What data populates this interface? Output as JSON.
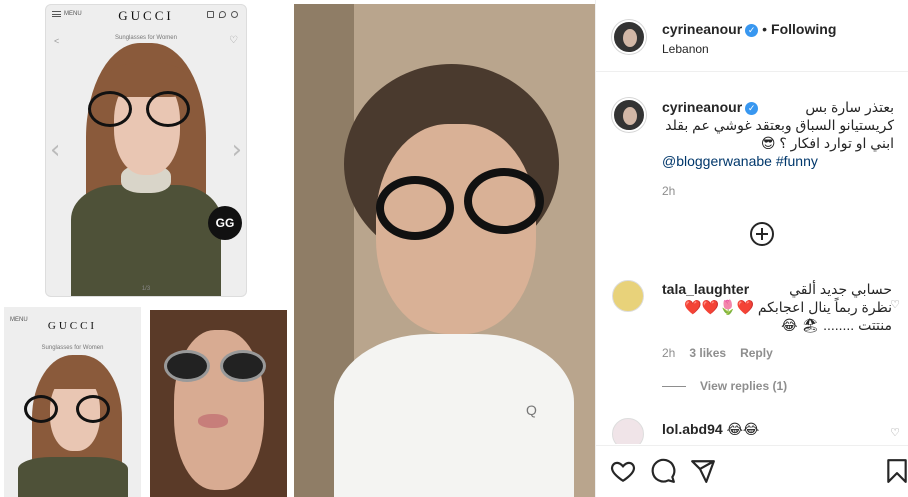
{
  "media": {
    "gucci_main": {
      "menu_label": "MENU",
      "brand": "GUCCI",
      "subtitle": "Sunglasses for Women",
      "page_indicator": "1/3",
      "badge": "GG"
    },
    "gucci_small": {
      "menu_label": "MENU",
      "brand": "GUCCI",
      "subtitle": "Sunglasses for Women"
    },
    "toddler_shirt_logo": "Q"
  },
  "post": {
    "author": "cyrineanour",
    "follow_status": "Following",
    "location": "Lebanon",
    "caption": {
      "line1": "بعتذر سارة بس",
      "line2": "كريستيانو السباق وبعتقد غوشي عم بقلد",
      "line3": "ابني او توارد افكار ؟ 😎",
      "tags": "@bloggerwanabe #funny",
      "time": "2h"
    },
    "comments": [
      {
        "user": "tala_laughter",
        "line1": "حسابي جديد ألقي",
        "line2": "نظرة ربماً ينال اعجابكم ❤️🌷❤️❤️",
        "line3": "منتتت ........ 🏖 😂",
        "time": "2h",
        "likes": "3 likes",
        "reply": "Reply"
      },
      {
        "user": "lol.abd94",
        "text": "😂😂"
      }
    ],
    "view_replies": "View replies (1)"
  },
  "colors": {
    "link": "#00376b",
    "verified": "#3897f0",
    "muted": "#8e8e8e"
  }
}
